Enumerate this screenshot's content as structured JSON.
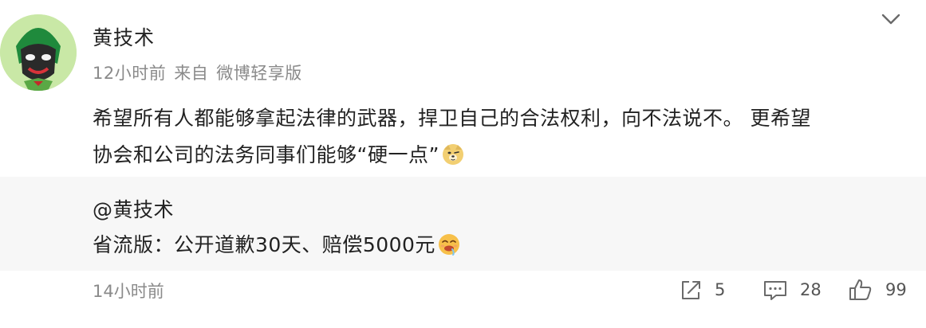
{
  "post": {
    "author": "黄技术",
    "time": "12小时前",
    "source_prefix": "来自",
    "source": "微博轻享版",
    "text_line1": "希望所有人都能够拿起法律的武器，捍卫自己的合法权利，向不法说不。 更希望",
    "text_line2": "协会和公司的法务同事们能够“硬一点”",
    "emoji": "doge-emoji"
  },
  "repost": {
    "author": "@黄技术",
    "text": "省流版：公开道歉30天、赔偿5000元",
    "emoji": "drooling-emoji",
    "time": "14小时前"
  },
  "actions": {
    "share_count": "5",
    "comment_count": "28",
    "like_count": "99"
  },
  "icons": {
    "menu": "chevron-down-icon",
    "share": "share-icon",
    "comment": "comment-icon",
    "like": "thumbs-up-icon"
  },
  "colors": {
    "text": "#222222",
    "meta": "#8a8a8a",
    "repost_bg": "#f7f7f7",
    "avatar_bg": "#c7e6a4"
  }
}
